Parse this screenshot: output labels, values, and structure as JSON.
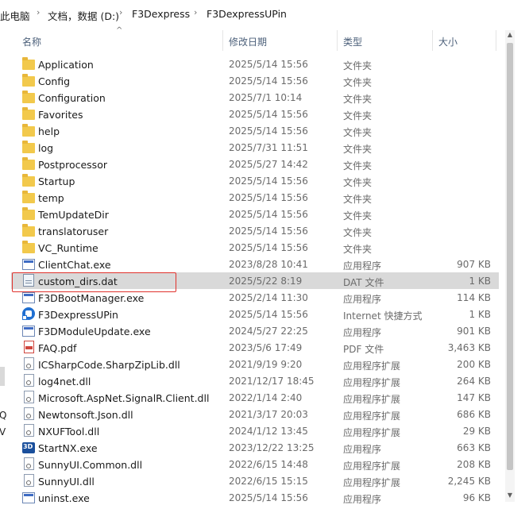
{
  "breadcrumb": {
    "items": [
      "此电脑",
      "文档，数据 (D:)",
      "F3Dexpress",
      "F3DexpressUPin"
    ],
    "separator": "›"
  },
  "left_edge_chars": [
    "Q",
    "V"
  ],
  "columns": {
    "name": "名称",
    "date": "修改日期",
    "type": "类型",
    "size": "大小",
    "sort_indicator": "^"
  },
  "files": [
    {
      "name": "Application",
      "date": "2025/5/14 15:56",
      "type": "文件夹",
      "size": "",
      "icon": "folder-icon"
    },
    {
      "name": "Config",
      "date": "2025/5/14 15:56",
      "type": "文件夹",
      "size": "",
      "icon": "folder-icon"
    },
    {
      "name": "Configuration",
      "date": "2025/7/1 10:14",
      "type": "文件夹",
      "size": "",
      "icon": "folder-icon"
    },
    {
      "name": "Favorites",
      "date": "2025/5/14 15:56",
      "type": "文件夹",
      "size": "",
      "icon": "folder-icon"
    },
    {
      "name": "help",
      "date": "2025/5/14 15:56",
      "type": "文件夹",
      "size": "",
      "icon": "folder-icon"
    },
    {
      "name": "log",
      "date": "2025/7/31 11:51",
      "type": "文件夹",
      "size": "",
      "icon": "folder-icon"
    },
    {
      "name": "Postprocessor",
      "date": "2025/5/27 14:42",
      "type": "文件夹",
      "size": "",
      "icon": "folder-icon"
    },
    {
      "name": "Startup",
      "date": "2025/5/14 15:56",
      "type": "文件夹",
      "size": "",
      "icon": "folder-icon"
    },
    {
      "name": "temp",
      "date": "2025/5/14 15:56",
      "type": "文件夹",
      "size": "",
      "icon": "folder-icon"
    },
    {
      "name": "TemUpdateDir",
      "date": "2025/5/14 15:56",
      "type": "文件夹",
      "size": "",
      "icon": "folder-icon"
    },
    {
      "name": "translatoruser",
      "date": "2025/5/14 15:56",
      "type": "文件夹",
      "size": "",
      "icon": "folder-icon"
    },
    {
      "name": "VC_Runtime",
      "date": "2025/5/14 15:56",
      "type": "文件夹",
      "size": "",
      "icon": "folder-icon"
    },
    {
      "name": "ClientChat.exe",
      "date": "2023/8/28 10:41",
      "type": "应用程序",
      "size": "907 KB",
      "icon": "exe-icon"
    },
    {
      "name": "custom_dirs.dat",
      "date": "2025/5/22 8:19",
      "type": "DAT 文件",
      "size": "1 KB",
      "icon": "dat-file-icon",
      "selected": true
    },
    {
      "name": "F3DBootManager.exe",
      "date": "2025/2/14 11:30",
      "type": "应用程序",
      "size": "114 KB",
      "icon": "exe-icon"
    },
    {
      "name": "F3DexpressUPin",
      "date": "2025/5/14 15:56",
      "type": "Internet 快捷方式",
      "size": "1 KB",
      "icon": "shortcut-icon"
    },
    {
      "name": "F3DModuleUpdate.exe",
      "date": "2024/5/27 22:25",
      "type": "应用程序",
      "size": "901 KB",
      "icon": "exe-icon"
    },
    {
      "name": "FAQ.pdf",
      "date": "2023/5/6 17:49",
      "type": "PDF 文件",
      "size": "3,463 KB",
      "icon": "pdf-icon"
    },
    {
      "name": "ICSharpCode.SharpZipLib.dll",
      "date": "2021/9/19 9:20",
      "type": "应用程序扩展",
      "size": "200 KB",
      "icon": "dll-icon"
    },
    {
      "name": "log4net.dll",
      "date": "2021/12/17 18:45",
      "type": "应用程序扩展",
      "size": "264 KB",
      "icon": "dll-icon"
    },
    {
      "name": "Microsoft.AspNet.SignalR.Client.dll",
      "date": "2022/1/14 2:40",
      "type": "应用程序扩展",
      "size": "147 KB",
      "icon": "dll-icon"
    },
    {
      "name": "Newtonsoft.Json.dll",
      "date": "2021/3/17 20:03",
      "type": "应用程序扩展",
      "size": "686 KB",
      "icon": "dll-icon"
    },
    {
      "name": "NXUFTool.dll",
      "date": "2024/1/12 13:45",
      "type": "应用程序扩展",
      "size": "29 KB",
      "icon": "dll-icon"
    },
    {
      "name": "StartNX.exe",
      "date": "2023/12/22 13:25",
      "type": "应用程序",
      "size": "663 KB",
      "icon": "nx-app-icon"
    },
    {
      "name": "SunnyUI.Common.dll",
      "date": "2022/6/15 14:48",
      "type": "应用程序扩展",
      "size": "208 KB",
      "icon": "dll-icon"
    },
    {
      "name": "SunnyUI.dll",
      "date": "2022/6/15 15:15",
      "type": "应用程序扩展",
      "size": "2,245 KB",
      "icon": "dll-icon"
    },
    {
      "name": "uninst.exe",
      "date": "2025/5/14 15:56",
      "type": "应用程序",
      "size": "96 KB",
      "icon": "exe-icon"
    }
  ],
  "colors": {
    "selection": "#d9d9d9",
    "highlight_border": "#e0322d",
    "folder": "#f2c94c",
    "header_text": "#4c607a"
  }
}
